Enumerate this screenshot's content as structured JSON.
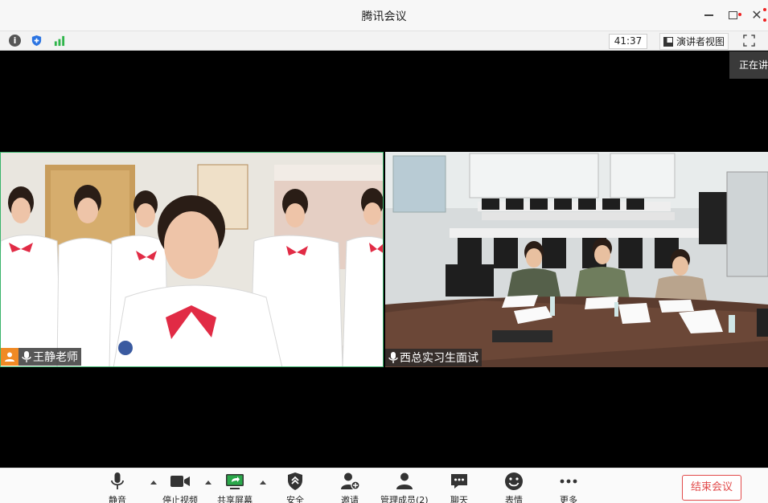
{
  "window": {
    "title": "腾讯会议"
  },
  "infobar": {
    "timer": "41:37",
    "presenter_view_label": "演讲者视图"
  },
  "speaking_tag": "正在讲",
  "tiles": [
    {
      "name": "王静老师",
      "active_speaker": true
    },
    {
      "name": "西总实习生面试",
      "active_speaker": false
    }
  ],
  "toolbar": {
    "mute": "静音",
    "stop_video": "停止视频",
    "share_screen": "共享屏幕",
    "security": "安全",
    "invite": "邀请",
    "manage_members": "管理成员(2)",
    "chat": "聊天",
    "reactions": "表情",
    "more": "更多",
    "end_meeting": "结束会议"
  },
  "colors": {
    "accent_green": "#39b36b",
    "end_red": "#e24a4a",
    "avatar_orange": "#f08a24"
  }
}
